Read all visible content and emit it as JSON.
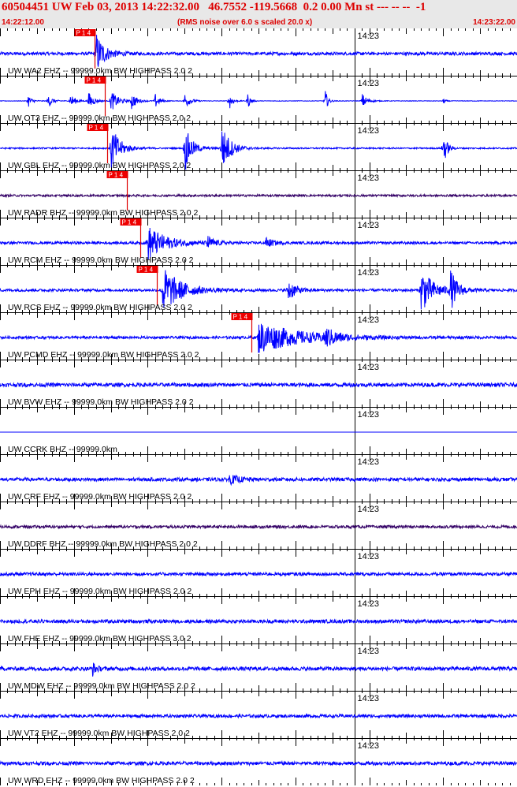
{
  "header": {
    "event_line": "60504451 UW Feb 03, 2013 14:22:32.00   46.7552 -119.5668  0.2 0.00 Mn st --- -- --  -1",
    "start_time": "14:22:12.00",
    "noise_note": "(RMS noise over 6.0 s scaled 20.0 x)",
    "end_time": "14:23:22.00"
  },
  "colors": {
    "header_text": "#dd0000",
    "header_bg": "#e8e8e8",
    "trace": "#0000ff",
    "trace_dark": "#330066",
    "pick": "#dd0000",
    "pick_label_bg": "#ee0000"
  },
  "chart_data": {
    "type": "line",
    "title": "60504451 UW Feb 03, 2013 14:22:32.00",
    "x_start": "14:22:12.00",
    "x_end": "14:23:22.00",
    "xlim_seconds": [
      0,
      70
    ],
    "minute_label": "14:23",
    "pick_label": "P 1 4",
    "traces": [
      {
        "label": "UW WA2 EHZ -- 99999.0km BW  HIGHPASS  2.0  2",
        "color": "#0000ff",
        "noise": 0.18,
        "pick_time_s": 12.8,
        "bursts": [
          {
            "t": 13.0,
            "amp": 2.4,
            "width": 2.5
          }
        ]
      },
      {
        "label": "UW OT3 EHZ -- 99999.0km BW  HIGHPASS  2.0  2",
        "color": "#0000ff",
        "noise": 0.03,
        "pick_time_s": 14.2,
        "bursts": [
          {
            "t": 3.8,
            "amp": 0.8,
            "width": 1.0
          },
          {
            "t": 6.5,
            "amp": 0.9,
            "width": 1.2
          },
          {
            "t": 9.5,
            "amp": 0.9,
            "width": 1.4
          },
          {
            "t": 12.0,
            "amp": 1.0,
            "width": 1.5
          },
          {
            "t": 15.0,
            "amp": 1.3,
            "width": 2.0
          },
          {
            "t": 17.8,
            "amp": 1.0,
            "width": 1.5
          },
          {
            "t": 21.0,
            "amp": 0.9,
            "width": 1.2
          },
          {
            "t": 25.0,
            "amp": 1.0,
            "width": 1.5
          },
          {
            "t": 31.0,
            "amp": 1.1,
            "width": 1.0
          },
          {
            "t": 33.5,
            "amp": 1.0,
            "width": 0.8
          },
          {
            "t": 44.0,
            "amp": 1.4,
            "width": 0.8
          },
          {
            "t": 49.0,
            "amp": 0.9,
            "width": 1.5
          },
          {
            "t": 60.0,
            "amp": 0.5,
            "width": 0.5
          }
        ]
      },
      {
        "label": "UW GBL EHZ -- 99999.0km BW  HIGHPASS  2.0  2",
        "color": "#0000ff",
        "noise": 0.08,
        "pick_time_s": 14.5,
        "bursts": [
          {
            "t": 15.0,
            "amp": 2.8,
            "width": 2.5
          },
          {
            "t": 25.0,
            "amp": 2.8,
            "width": 2.0
          },
          {
            "t": 30.0,
            "amp": 2.8,
            "width": 2.5
          },
          {
            "t": 60.0,
            "amp": 2.2,
            "width": 1.0
          }
        ]
      },
      {
        "label": "UW RADR BHZ -- 99999.0km BW  HIGHPASS  2.0  2",
        "color": "#330066",
        "noise": 0.12,
        "pick_time_s": 17.2,
        "bursts": []
      },
      {
        "label": "UW RCM EHZ -- 99999.0km BW  HIGHPASS  2.0  2",
        "color": "#0000ff",
        "noise": 0.15,
        "pick_time_s": 19.0,
        "bursts": [
          {
            "t": 20.0,
            "amp": 2.0,
            "width": 5.0
          },
          {
            "t": 28.0,
            "amp": 0.8,
            "width": 2.0
          },
          {
            "t": 36.0,
            "amp": 0.6,
            "width": 2.0
          }
        ]
      },
      {
        "label": "UW RCS EHZ -- 99999.0km BW  HIGHPASS  2.0  2",
        "color": "#0000ff",
        "noise": 0.15,
        "pick_time_s": 21.2,
        "bursts": [
          {
            "t": 22.0,
            "amp": 2.8,
            "width": 5.0
          },
          {
            "t": 39.0,
            "amp": 1.4,
            "width": 2.0
          },
          {
            "t": 57.0,
            "amp": 2.6,
            "width": 3.5
          },
          {
            "t": 61.0,
            "amp": 2.2,
            "width": 2.0
          }
        ]
      },
      {
        "label": "UW PCMD EHZ -- 99999.0km BW  HIGHPASS  2.0  2",
        "color": "#0000ff",
        "noise": 0.15,
        "pick_time_s": 34.0,
        "bursts": [
          {
            "t": 35.0,
            "amp": 1.8,
            "width": 12.0
          },
          {
            "t": 44.0,
            "amp": 1.0,
            "width": 3.0
          }
        ]
      },
      {
        "label": "UW BVW EHZ -- 99999.0km BW  HIGHPASS  2.0  2",
        "color": "#0000ff",
        "noise": 0.22,
        "pick_time_s": null,
        "bursts": []
      },
      {
        "label": "UW CCRK BHZ -- 99999.0km",
        "color": "#0000ff",
        "noise": 0.0,
        "pick_time_s": null,
        "bursts": []
      },
      {
        "label": "UW CRF EHZ -- 99999.0km BW  HIGHPASS  2.0  2",
        "color": "#0000ff",
        "noise": 0.2,
        "pick_time_s": null,
        "bursts": [
          {
            "t": 31.0,
            "amp": 0.5,
            "width": 3.0
          }
        ]
      },
      {
        "label": "UW DDRF BHZ -- 99999.0km BW  HIGHPASS  2.0  2",
        "color": "#330066",
        "noise": 0.16,
        "pick_time_s": null,
        "bursts": []
      },
      {
        "label": "UW EPH EHZ -- 99999.0km BW  HIGHPASS  2.0  2",
        "color": "#0000ff",
        "noise": 0.18,
        "pick_time_s": null,
        "bursts": []
      },
      {
        "label": "UW FHE EHZ -- 99999.0km BW  HIGHPASS  3.0  2",
        "color": "#0000ff",
        "noise": 0.2,
        "pick_time_s": null,
        "bursts": []
      },
      {
        "label": "UW MDW EHZ -- 99999.0km BW  HIGHPASS  2.0  2",
        "color": "#0000ff",
        "noise": 0.22,
        "pick_time_s": null,
        "bursts": [
          {
            "t": 12.5,
            "amp": 0.8,
            "width": 1.0
          }
        ]
      },
      {
        "label": "UW VT2 EHZ -- 99999.0km BW  HIGHPASS  2.0  2",
        "color": "#0000ff",
        "noise": 0.18,
        "pick_time_s": null,
        "bursts": []
      },
      {
        "label": "UW WRD EHZ -- 99999.0km BW  HIGHPASS  2.0  2",
        "color": "#0000ff",
        "noise": 0.2,
        "pick_time_s": null,
        "bursts": []
      }
    ]
  }
}
